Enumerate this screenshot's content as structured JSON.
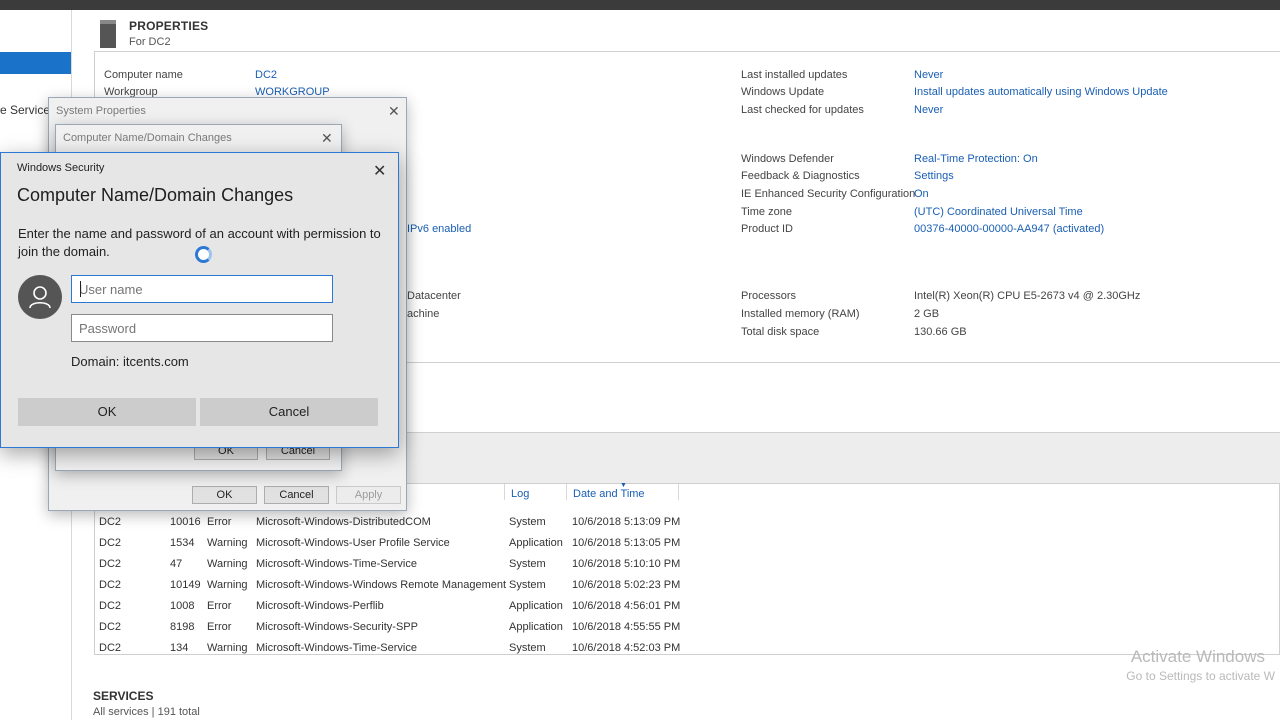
{
  "left": {
    "services_label": "e Services"
  },
  "properties": {
    "title": "PROPERTIES",
    "subtitle": "For DC2"
  },
  "left_props": [
    {
      "label": "Computer name",
      "value": "DC2"
    },
    {
      "label": "Workgroup",
      "value": "WORKGROUP"
    }
  ],
  "right_props_1": [
    {
      "label": "Last installed updates",
      "value": "Never"
    },
    {
      "label": "Windows Update",
      "value": "Install updates automatically using Windows Update"
    },
    {
      "label": "Last checked for updates",
      "value": "Never"
    }
  ],
  "right_props_2": [
    {
      "label": "Windows Defender",
      "value": "Real-Time Protection: On"
    },
    {
      "label": "Feedback & Diagnostics",
      "value": "Settings"
    },
    {
      "label": "IE Enhanced Security Configuration",
      "value": "On"
    },
    {
      "label": "Time zone",
      "value": "(UTC) Coordinated Universal Time"
    },
    {
      "label": "Product ID",
      "value": "00376-40000-00000-AA947 (activated)"
    }
  ],
  "right_props_3": [
    {
      "label": "Processors",
      "value": "Intel(R) Xeon(R) CPU E5-2673 v4 @ 2.30GHz"
    },
    {
      "label": "Installed memory (RAM)",
      "value": "2 GB"
    },
    {
      "label": "Total disk space",
      "value": "130.66 GB"
    }
  ],
  "partial": {
    "ipv6": "IPv6 enabled",
    "datacenter": "Datacenter",
    "machine": "achine"
  },
  "events": {
    "col_log": "Log",
    "col_date": "Date and Time",
    "rows": [
      {
        "server": "DC2",
        "id": "10016",
        "severity": "Error",
        "source": "Microsoft-Windows-DistributedCOM",
        "log": "System",
        "date": "10/6/2018 5:13:09 PM"
      },
      {
        "server": "DC2",
        "id": "1534",
        "severity": "Warning",
        "source": "Microsoft-Windows-User Profile Service",
        "log": "Application",
        "date": "10/6/2018 5:13:05 PM"
      },
      {
        "server": "DC2",
        "id": "47",
        "severity": "Warning",
        "source": "Microsoft-Windows-Time-Service",
        "log": "System",
        "date": "10/6/2018 5:10:10 PM"
      },
      {
        "server": "DC2",
        "id": "10149",
        "severity": "Warning",
        "source": "Microsoft-Windows-Windows Remote Management",
        "log": "System",
        "date": "10/6/2018 5:02:23 PM"
      },
      {
        "server": "DC2",
        "id": "1008",
        "severity": "Error",
        "source": "Microsoft-Windows-Perflib",
        "log": "Application",
        "date": "10/6/2018 4:56:01 PM"
      },
      {
        "server": "DC2",
        "id": "8198",
        "severity": "Error",
        "source": "Microsoft-Windows-Security-SPP",
        "log": "Application",
        "date": "10/6/2018 4:55:55 PM"
      },
      {
        "server": "DC2",
        "id": "134",
        "severity": "Warning",
        "source": "Microsoft-Windows-Time-Service",
        "log": "System",
        "date": "10/6/2018 4:52:03 PM"
      }
    ]
  },
  "services": {
    "title": "SERVICES",
    "subtitle": "All services | 191 total"
  },
  "watermark": {
    "line1": "Activate Windows",
    "line2": "Go to Settings to activate W"
  },
  "system_properties": {
    "title": "System Properties",
    "ok": "OK",
    "cancel": "Cancel",
    "apply": "Apply"
  },
  "domain_changes": {
    "title": "Computer Name/Domain Changes",
    "ok": "OK",
    "cancel": "Cancel"
  },
  "windows_security": {
    "title": "Windows Security",
    "heading": "Computer Name/Domain Changes",
    "message": "Enter the name and password of an account with permission to join the domain.",
    "username_placeholder": "User name",
    "password_placeholder": "Password",
    "domain": "Domain: itcents.com",
    "ok": "OK",
    "cancel": "Cancel"
  }
}
